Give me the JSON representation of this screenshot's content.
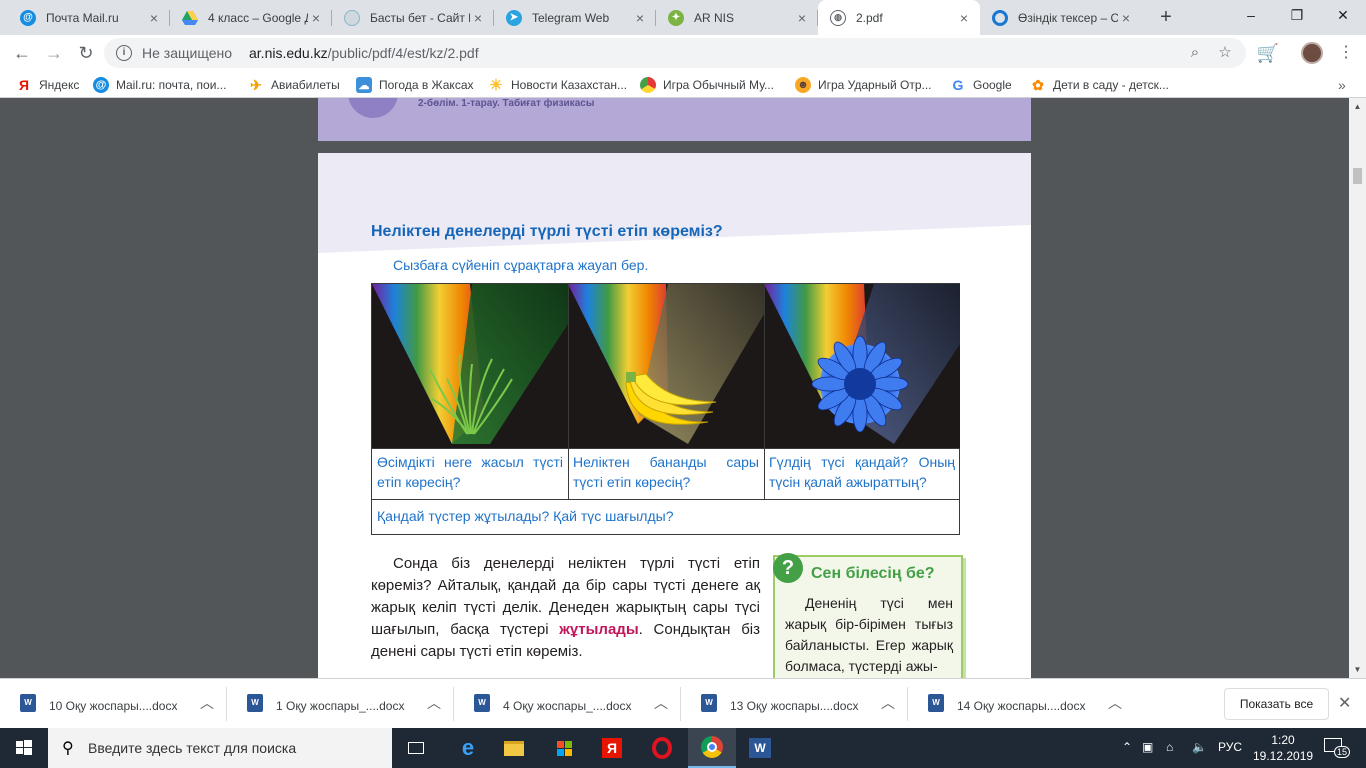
{
  "browser": {
    "tabs": [
      {
        "title": "Почта Mail.ru",
        "icon": "mailru-icon",
        "color": "#168de2"
      },
      {
        "title": "4 класс – Google Д",
        "icon": "google-drive-icon",
        "color": "#1fa463"
      },
      {
        "title": "Басты бет - Сайт N",
        "icon": "site-icon",
        "color": "#8ab4c9"
      },
      {
        "title": "Telegram Web",
        "icon": "telegram-icon",
        "color": "#2aa3e0"
      },
      {
        "title": "AR NIS",
        "icon": "ar-nis-icon",
        "color": "#7cb342"
      },
      {
        "title": "2.pdf",
        "icon": "pdf-globe-icon",
        "color": "#5f6368"
      },
      {
        "title": "Өзіндік тексер – Ор",
        "icon": "circle-o-icon",
        "color": "#1976d2"
      }
    ],
    "active_tab_index": 5,
    "window_controls": {
      "minimize": "–",
      "maximize": "❐",
      "close": "✕"
    },
    "address": {
      "security_label": "Не защищено",
      "url_host": "ar.nis.edu.kz",
      "url_path": "/public/pdf/4/est/kz/2.pdf"
    },
    "bookmarks": [
      {
        "label": "Яндекс",
        "icon": "yandex-icon"
      },
      {
        "label": "Mail.ru: почта, пои...",
        "icon": "mailru-icon"
      },
      {
        "label": "Авиабилеты",
        "icon": "airplane-icon"
      },
      {
        "label": "Погода в Жаксах",
        "icon": "weather-icon"
      },
      {
        "label": "Новости Казахстан...",
        "icon": "sun-icon"
      },
      {
        "label": "Игра Обычный Му...",
        "icon": "game-icon"
      },
      {
        "label": "Игра Ударный Отр...",
        "icon": "mask-icon"
      },
      {
        "label": "Google",
        "icon": "google-icon"
      },
      {
        "label": "Дети в саду - детск...",
        "icon": "kids-icon"
      }
    ],
    "bookmarks_more": "»"
  },
  "pdf": {
    "prev_page_strip": "2-бөлім. 1-тарау. Табиғат физикасы",
    "heading": "Неліктен денелерді түрлі түсті етіп көреміз?",
    "instruction": "Сызбаға сүйеніп сұрақтарға жауап бер.",
    "figure": {
      "captions": [
        "Өсімдікті неге жасыл түсті етіп көресің?",
        "Неліктен бананды сары түсті етіп көресің?",
        "Гүлдің түсі қандай? Оның түсін қалай ажыраттың?"
      ],
      "question": "Қандай түстер жұтылады? Қай түс шағылды?"
    },
    "body": {
      "before": "Сонда біз денелерді неліктен түрлі түсті етіп көреміз? Айталық, қандай да бір сары түсті денеге ақ жарық келіп түсті делік. Денеден жарықтың сары түсі шағылып, басқа түстері ",
      "highlight": "жұтылады",
      "after": ". Сондықтан біз денені сары түсті етіп көреміз."
    },
    "did_you_know": {
      "badge": "?",
      "title": "Сен білесің бе?",
      "text": "Дененің түсі мен жарық бір-бірімен тығыз байланысты. Егер жарық болмаса, түстерді ажы-"
    }
  },
  "downloads": {
    "items": [
      {
        "name": "10 Оқу жоспары....docx"
      },
      {
        "name": "1 Оқу жоспары_....docx"
      },
      {
        "name": "4 Оқу жоспары_....docx"
      },
      {
        "name": "13 Оқу жоспары....docx"
      },
      {
        "name": "14 Оқу жоспары....docx"
      }
    ],
    "show_all": "Показать все"
  },
  "taskbar": {
    "search_placeholder": "Введите здесь текст для поиска",
    "language": "РУС",
    "time": "1:20",
    "date": "19.12.2019",
    "notifications": "15"
  },
  "colors": {
    "heading_blue": "#1565b8",
    "caption_blue": "#1f73c9",
    "highlight_magenta": "#c2185b",
    "didyouknow_green": "#43a047"
  }
}
